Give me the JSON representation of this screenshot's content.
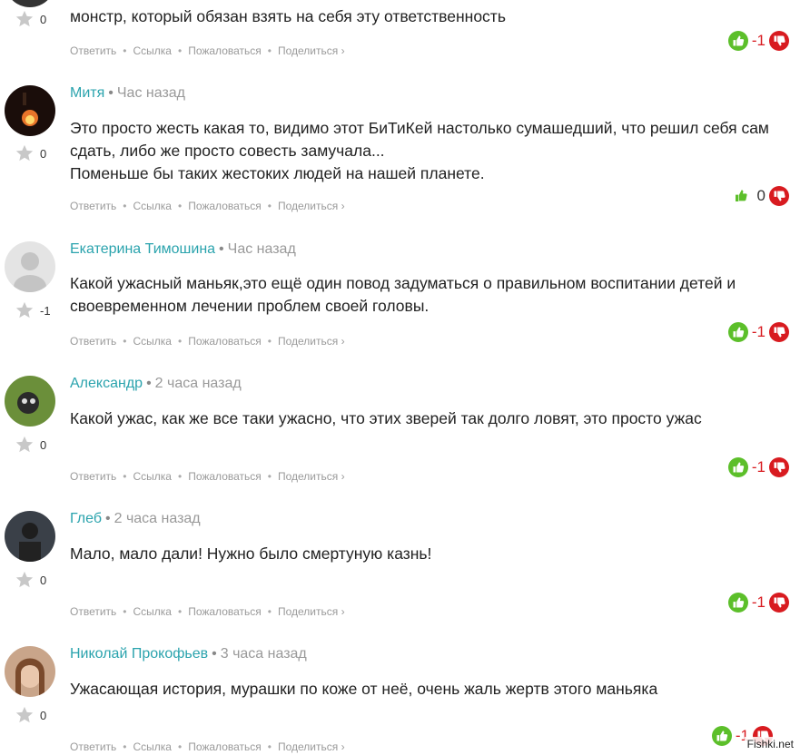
{
  "colors": {
    "author": "#2aa3ad",
    "time": "#999999",
    "vote_up": "#5cbf2a",
    "vote_down": "#d81b20"
  },
  "actions": {
    "reply": "Ответить",
    "link": "Ссылка",
    "report": "Пожаловаться",
    "share": "Поделиться ›"
  },
  "top_partial": {
    "text_line": "монстр, который обязан взять на себя эту ответственность",
    "rating": "0",
    "vote_count": "-1"
  },
  "comments": [
    {
      "author": "Митя",
      "time": "Час назад",
      "rating": "0",
      "text": [
        "Это просто жесть какая то, видимо этот БиТиКей настолько сумашедший, что решил себя сам",
        "сдать, либо же просто совесть замучала...",
        "Поменьше бы таких жестоких людей на нашей планете."
      ],
      "vote_count": "0"
    },
    {
      "author": "Екатерина Тимошина",
      "time": "Час назад",
      "rating": "-1",
      "text": [
        "Какой ужасный маньяк,это ещё один повод задуматься о правильном воспитании детей и",
        "своевременном лечении проблем своей головы."
      ],
      "vote_count": "-1"
    },
    {
      "author": "Александр",
      "time": "2 часа назад",
      "rating": "0",
      "text": [
        "Какой ужас, как же все таки ужасно, что этих зверей так долго ловят, это просто ужас"
      ],
      "vote_count": "-1"
    },
    {
      "author": "Глеб",
      "time": "2 часа назад",
      "rating": "0",
      "text": [
        "Мало, мало дали! Нужно было смертуную казнь!"
      ],
      "vote_count": "-1"
    },
    {
      "author": "Николай Прокофьев",
      "time": "3 часа назад",
      "rating": "0",
      "text": [
        "Ужасающая история, мурашки по коже от неё, очень жаль жертв этого маньяка"
      ],
      "vote_count": "-1"
    }
  ],
  "watermark": "Fishki.net"
}
